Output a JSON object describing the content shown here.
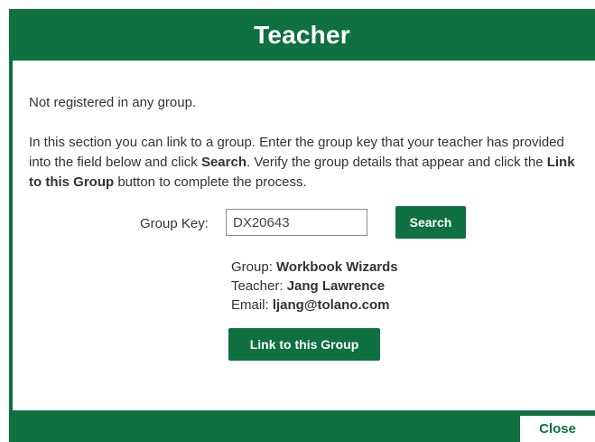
{
  "header": {
    "title": "Teacher"
  },
  "status": {
    "text": "Not registered in any group."
  },
  "instructions": {
    "part1": "In this section you can link to a group. Enter the group key that your teacher has provided into the field below and click ",
    "search_word": "Search",
    "part2": ". Verify the group details that appear and click the ",
    "link_word": "Link to this Group",
    "part3": " button to complete the process."
  },
  "group_key": {
    "label": "Group Key:",
    "value": "DX20643",
    "search_label": "Search"
  },
  "group_details": {
    "group_label": "Group: ",
    "group_value": "Workbook Wizards",
    "teacher_label": "Teacher: ",
    "teacher_value": "Jang Lawrence",
    "email_label": "Email: ",
    "email_value": "ljang@tolano.com"
  },
  "link_button": {
    "label": "Link to this Group"
  },
  "footer": {
    "close_label": "Close"
  },
  "colors": {
    "brand_green": "#0f7040",
    "text": "#333333",
    "background": "#ffffff"
  }
}
